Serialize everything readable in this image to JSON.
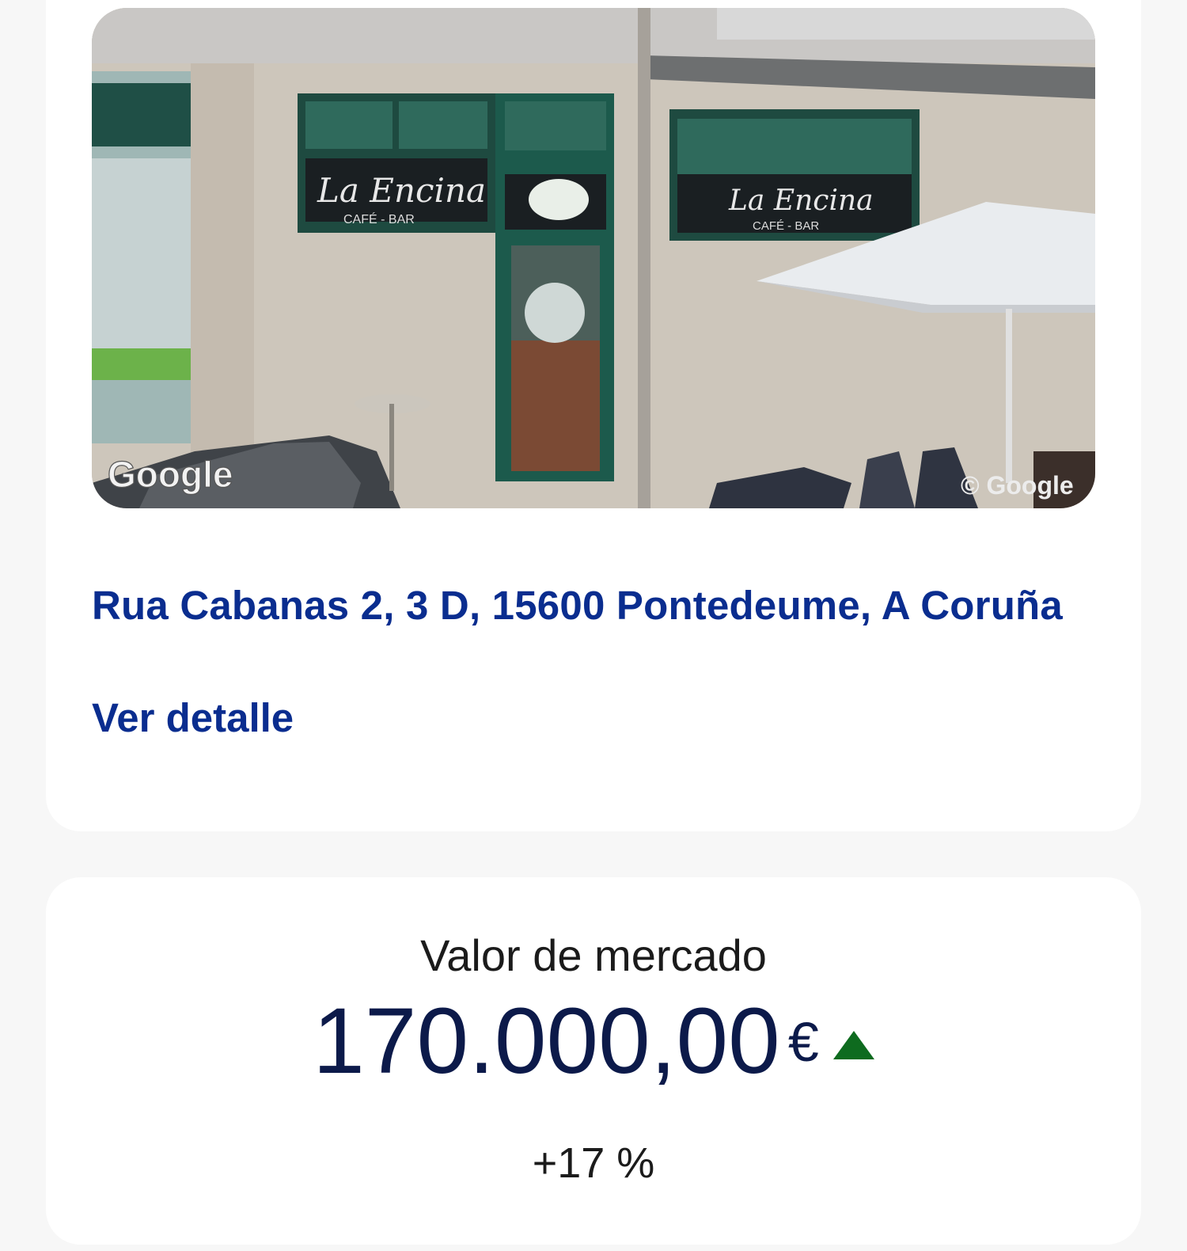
{
  "property": {
    "photo": {
      "watermark_left": "Google",
      "watermark_right": "© Google",
      "sign_text": "La Encina",
      "sign_subtext": "CAFÉ - BAR"
    },
    "address": "Rua Cabanas 2, 3 D, 15600 Pontedeume, A Coruña",
    "detail_link": "Ver detalle"
  },
  "market_value": {
    "label": "Valor de mercado",
    "value": "170.000,00",
    "currency": "€",
    "trend": "up",
    "change": "+17 %",
    "trend_color": "#0e6b1f"
  }
}
